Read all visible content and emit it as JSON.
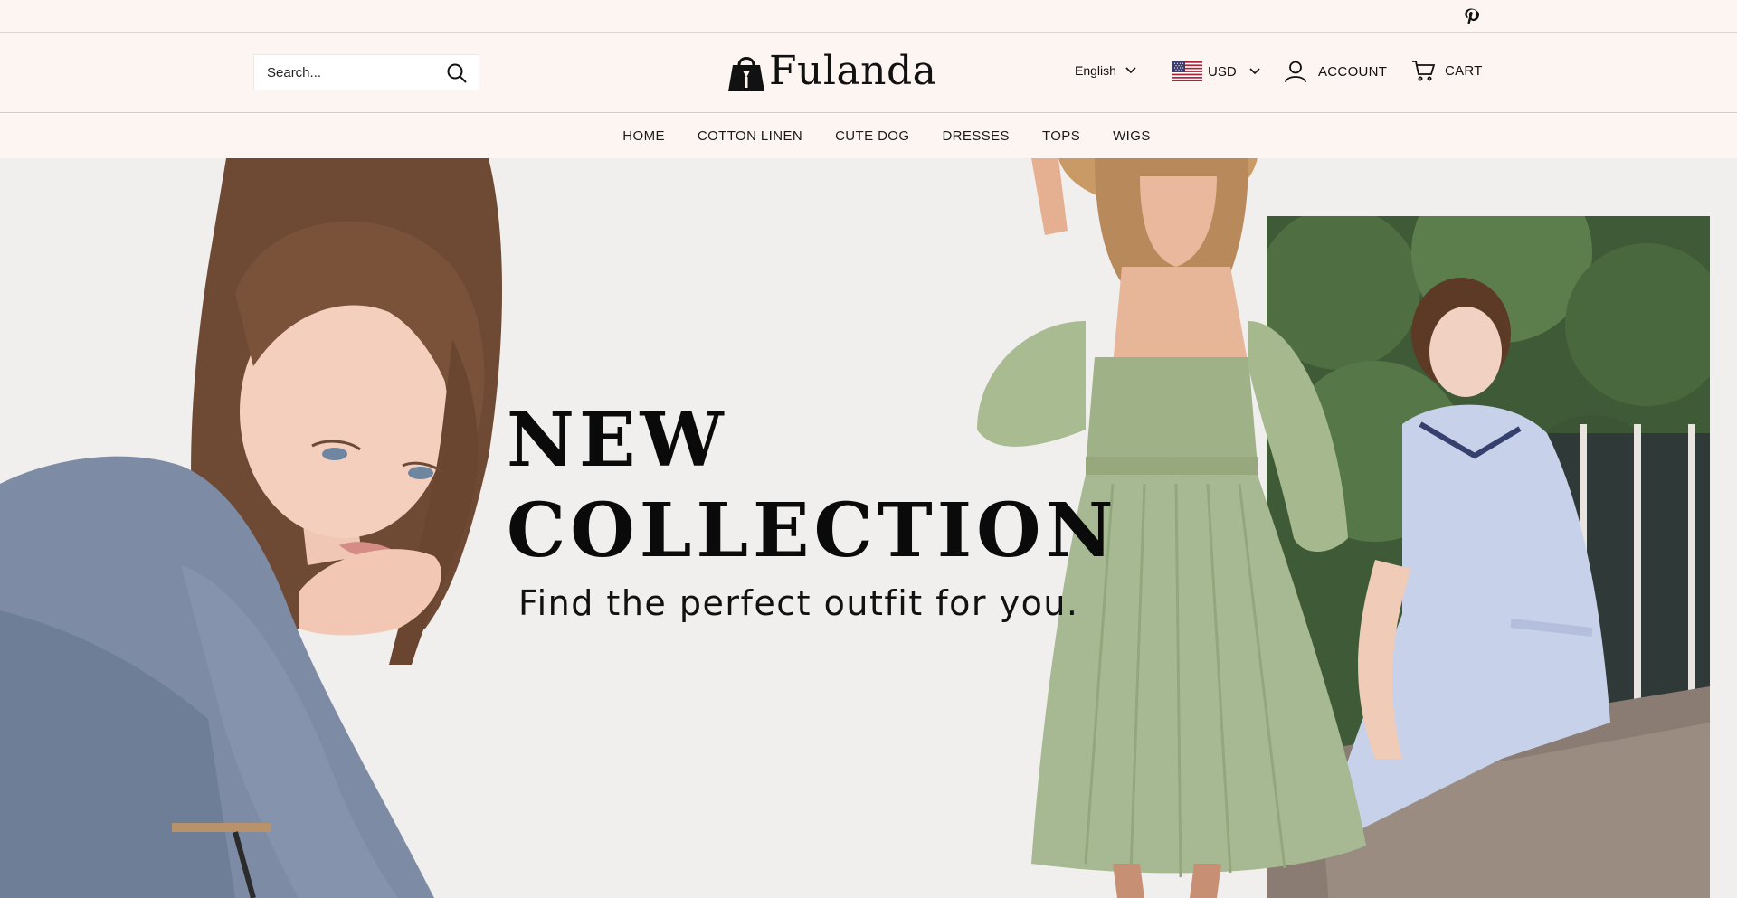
{
  "brand": {
    "name": "Fulanda"
  },
  "topbar": {
    "social_icon": "pinterest-icon"
  },
  "header": {
    "search_placeholder": "Search...",
    "language": "English",
    "currency": "USD",
    "account_label": "ACCOUNT",
    "cart_label": "CART"
  },
  "nav": {
    "items": [
      {
        "label": "HOME"
      },
      {
        "label": "COTTON LINEN"
      },
      {
        "label": "CUTE DOG"
      },
      {
        "label": "DRESSES"
      },
      {
        "label": "TOPS"
      },
      {
        "label": "WIGS"
      }
    ]
  },
  "hero": {
    "headline_line1": "NEW",
    "headline_line2": "COLLECTION",
    "subheading": "Find the perfect outfit for you."
  },
  "colors": {
    "header_bg": "#fdf5f2",
    "hero_bg": "#f0efed",
    "text": "#1a1a1a",
    "green_dress": "#a7b992",
    "grey_shirt": "#7f8ea6"
  }
}
